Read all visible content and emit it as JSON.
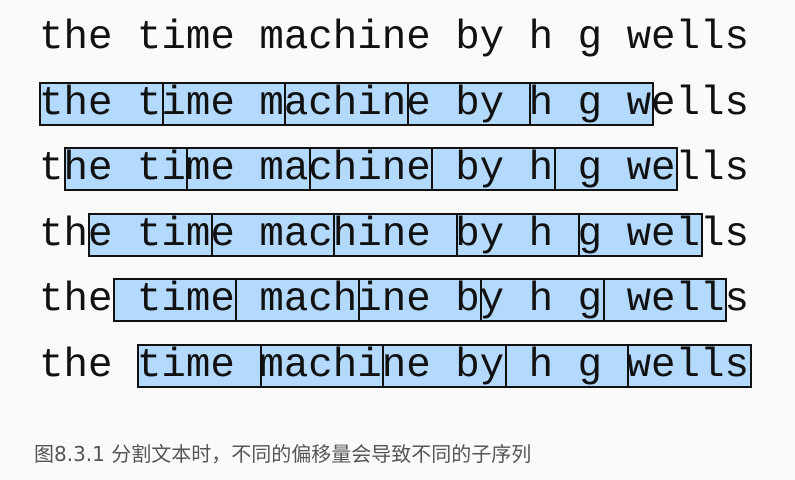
{
  "sentence": "the time machine by h g wells",
  "rows": [
    {
      "offset": null
    },
    {
      "offset": 0
    },
    {
      "offset": 1
    },
    {
      "offset": 2
    },
    {
      "offset": 3
    },
    {
      "offset": 4
    }
  ],
  "subsequence_length": 5,
  "subsequences_per_row": 5,
  "colors": {
    "box_fill": "#b3d9fd",
    "box_border": "#111111",
    "text": "#111111"
  },
  "caption": "图8.3.1  分割文本时，不同的偏移量会导致不同的子序列"
}
